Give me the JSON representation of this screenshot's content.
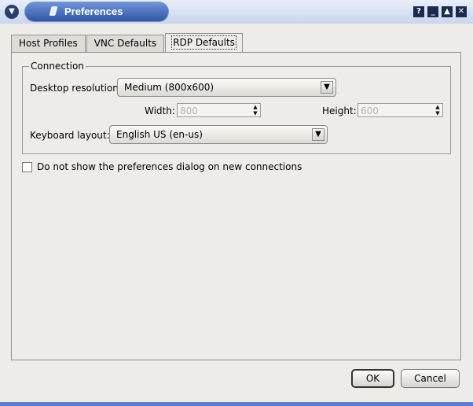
{
  "window": {
    "title": "Preferences"
  },
  "tabs": [
    {
      "label": "Host Profiles",
      "mnemonic": "H"
    },
    {
      "label": "VNC Defaults",
      "mnemonic": "V"
    },
    {
      "label": "RDP Defaults",
      "mnemonic": "R",
      "active": true
    }
  ],
  "connection": {
    "legend": "Connection",
    "desktop_resolution_label": "Desktop resolution:",
    "desktop_resolution_value": "Medium (800x600)",
    "width_label": "Width:",
    "width_value": "800",
    "height_label": "Height:",
    "height_value": "600",
    "keyboard_label": "Keyboard layout:",
    "keyboard_value": "English US (en-us)"
  },
  "checkbox": {
    "label": "Do not show the preferences dialog on new connections",
    "checked": false
  },
  "buttons": {
    "ok": "OK",
    "cancel": "Cancel"
  },
  "title_controls": [
    "help-icon",
    "minimize-icon",
    "maximize-icon",
    "close-icon"
  ]
}
